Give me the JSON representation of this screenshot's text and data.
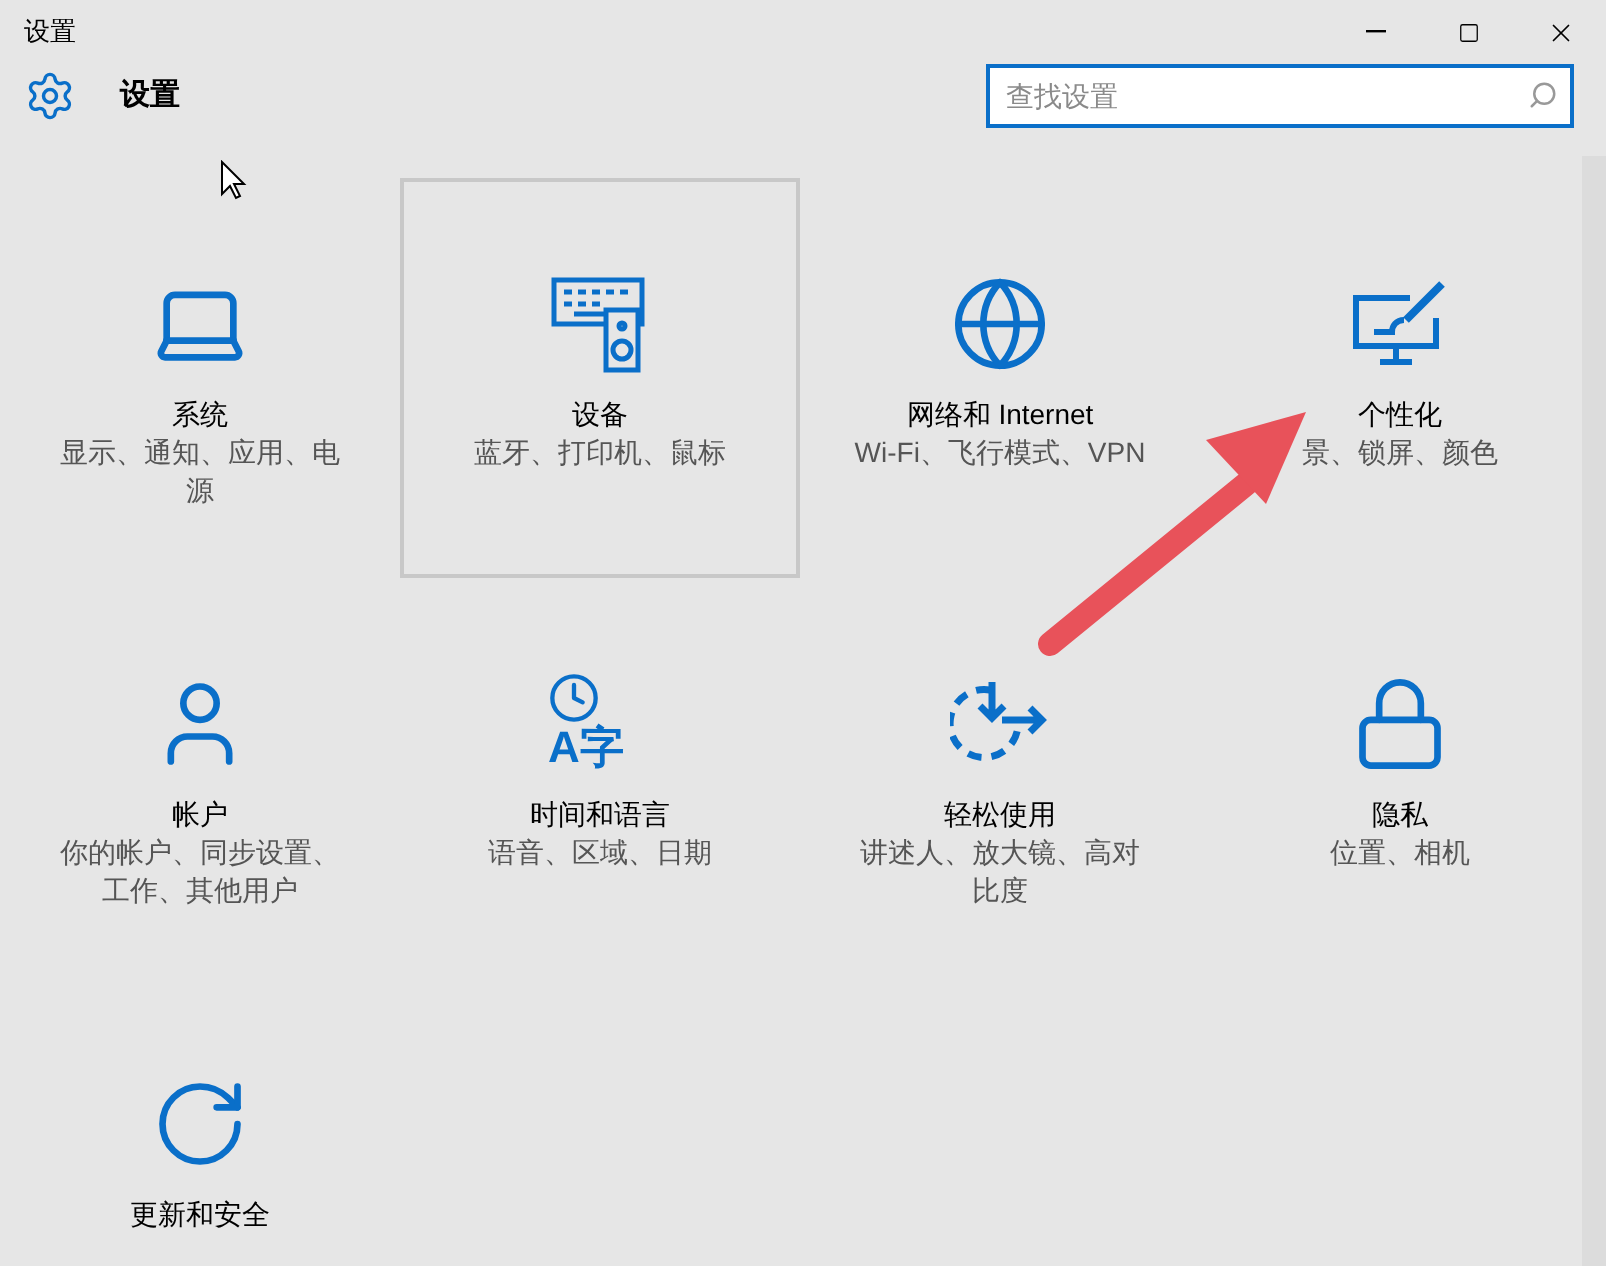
{
  "window": {
    "title": "设置"
  },
  "header": {
    "title": "设置",
    "search": {
      "placeholder": "查找设置"
    }
  },
  "tiles": [
    {
      "title": "系统",
      "description": "显示、通知、应用、电源",
      "selected": false
    },
    {
      "title": "设备",
      "description": "蓝牙、打印机、鼠标",
      "selected": true
    },
    {
      "title": "网络和 Internet",
      "description": "Wi-Fi、飞行模式、VPN",
      "selected": false
    },
    {
      "title": "个性化",
      "description": "景、锁屏、颜色",
      "selected": false
    },
    {
      "title": "帐户",
      "description": "你的帐户、同步设置、工作、其他用户",
      "selected": false
    },
    {
      "title": "时间和语言",
      "description": "语音、区域、日期",
      "icon_text": "A字",
      "selected": false
    },
    {
      "title": "轻松使用",
      "description": "讲述人、放大镜、高对比度",
      "selected": false
    },
    {
      "title": "隐私",
      "description": "位置、相机",
      "selected": false
    },
    {
      "title": "更新和安全",
      "selected": false
    }
  ]
}
